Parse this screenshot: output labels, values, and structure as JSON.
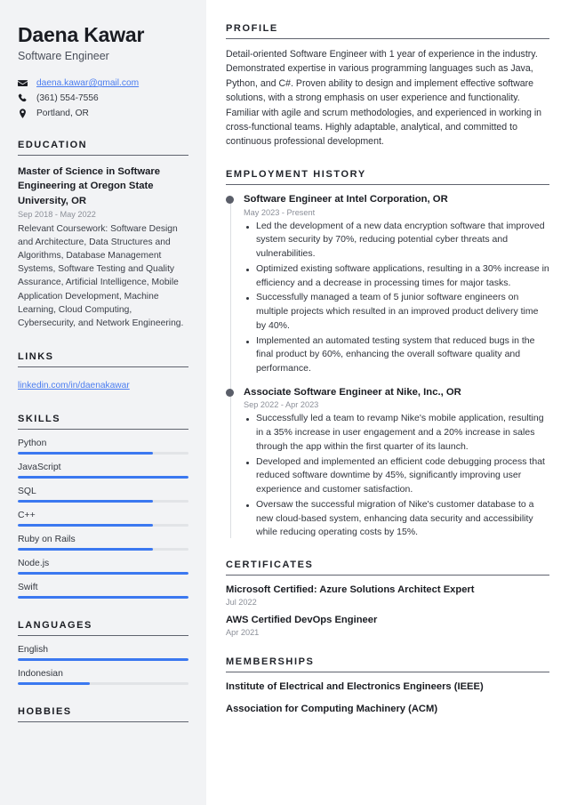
{
  "sidebar": {
    "name": "Daena Kawar",
    "job_title": "Software Engineer",
    "contact": {
      "email": "daena.kawar@gmail.com",
      "email_icon": "envelope-icon",
      "phone": "(361) 554-7556",
      "phone_icon": "phone-icon",
      "location": "Portland, OR",
      "location_icon": "map-pin-icon"
    },
    "education": {
      "heading": "EDUCATION",
      "entries": [
        {
          "degree": "Master of Science in Software Engineering at Oregon State University, OR",
          "date": "Sep 2018 - May 2022",
          "description": "Relevant Coursework: Software Design and Architecture, Data Structures and Algorithms, Database Management Systems, Software Testing and Quality Assurance, Artificial Intelligence, Mobile Application Development, Machine Learning, Cloud Computing, Cybersecurity, and Network Engineering."
        }
      ]
    },
    "links": {
      "heading": "LINKS",
      "items": [
        {
          "label": "linkedin.com/in/daenakawar"
        }
      ]
    },
    "skills": {
      "heading": "SKILLS",
      "items": [
        {
          "label": "Python",
          "level": 79
        },
        {
          "label": "JavaScript",
          "level": 100
        },
        {
          "label": "SQL",
          "level": 79
        },
        {
          "label": "C++",
          "level": 79
        },
        {
          "label": "Ruby on Rails",
          "level": 79
        },
        {
          "label": "Node.js",
          "level": 100
        },
        {
          "label": "Swift",
          "level": 100
        }
      ]
    },
    "languages": {
      "heading": "LANGUAGES",
      "items": [
        {
          "label": "English",
          "level": 100
        },
        {
          "label": "Indonesian",
          "level": 42
        }
      ]
    },
    "hobbies": {
      "heading": "HOBBIES"
    }
  },
  "main": {
    "profile": {
      "heading": "PROFILE",
      "text": "Detail-oriented Software Engineer with 1 year of experience in the industry. Demonstrated expertise in various programming languages such as Java, Python, and C#. Proven ability to design and implement effective software solutions, with a strong emphasis on user experience and functionality. Familiar with agile and scrum methodologies, and experienced in working in cross-functional teams. Highly adaptable, analytical, and committed to continuous professional development."
    },
    "employment": {
      "heading": "EMPLOYMENT HISTORY",
      "entries": [
        {
          "role": "Software Engineer at Intel Corporation, OR",
          "date": "May 2023 - Present",
          "bullets": [
            "Led the development of a new data encryption software that improved system security by 70%, reducing potential cyber threats and vulnerabilities.",
            "Optimized existing software applications, resulting in a 30% increase in efficiency and a decrease in processing times for major tasks.",
            "Successfully managed a team of 5 junior software engineers on multiple projects which resulted in an improved product delivery time by 40%.",
            "Implemented an automated testing system that reduced bugs in the final product by 60%, enhancing the overall software quality and performance."
          ]
        },
        {
          "role": "Associate Software Engineer at Nike, Inc., OR",
          "date": "Sep 2022 - Apr 2023",
          "bullets": [
            "Successfully led a team to revamp Nike's mobile application, resulting in a 35% increase in user engagement and a 20% increase in sales through the app within the first quarter of its launch.",
            "Developed and implemented an efficient code debugging process that reduced software downtime by 45%, significantly improving user experience and customer satisfaction.",
            "Oversaw the successful migration of Nike's customer database to a new cloud-based system, enhancing data security and accessibility while reducing operating costs by 15%."
          ]
        }
      ]
    },
    "certificates": {
      "heading": "CERTIFICATES",
      "entries": [
        {
          "title": "Microsoft Certified: Azure Solutions Architect Expert",
          "date": "Jul 2022"
        },
        {
          "title": "AWS Certified DevOps Engineer",
          "date": "Apr 2021"
        }
      ]
    },
    "memberships": {
      "heading": "MEMBERSHIPS",
      "entries": [
        {
          "title": "Institute of Electrical and Electronics Engineers (IEEE)"
        },
        {
          "title": "Association for Computing Machinery (ACM)"
        }
      ]
    }
  },
  "colors": {
    "sidebar_bg": "#f2f3f5",
    "accent": "#3b78f0",
    "link": "#4a7cf0",
    "heading": "#1a1c22",
    "muted": "#8b8f98"
  }
}
